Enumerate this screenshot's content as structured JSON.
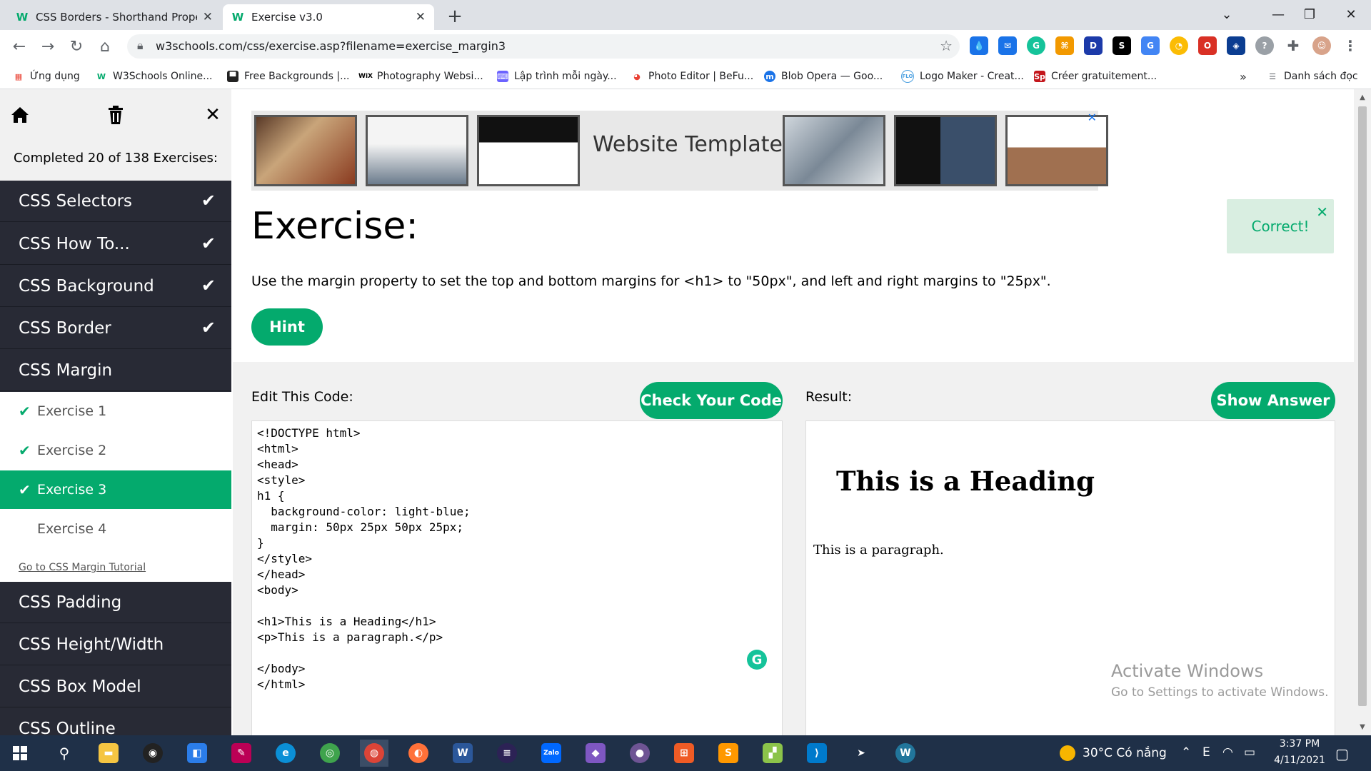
{
  "browser": {
    "tabs": [
      {
        "title": "CSS Borders - Shorthand Propert",
        "favicon": "W"
      },
      {
        "title": "Exercise v3.0",
        "favicon": "W"
      }
    ],
    "url": "w3schools.com/css/exercise.asp?filename=exercise_margin3",
    "bookmarks": [
      "Ứng dụng",
      "W3Schools Online...",
      "Free Backgrounds |...",
      "Photography Websi...",
      "Lập trình mỗi ngày...",
      "Photo Editor | BeFu...",
      "Blob Opera — Goo...",
      "Logo Maker - Creat...",
      "Créer gratuitement..."
    ],
    "reading_list": "Danh sách đọc",
    "bookmark_overflow": "»"
  },
  "sidebar": {
    "progress": "Completed 20 of 138 Exercises:",
    "categories_top": [
      {
        "label": "CSS Selectors",
        "done": true
      },
      {
        "label": "CSS How To...",
        "done": true
      },
      {
        "label": "CSS Background",
        "done": true
      },
      {
        "label": "CSS Border",
        "done": true
      },
      {
        "label": "CSS Margin",
        "done": false
      }
    ],
    "exercises": [
      {
        "label": "Exercise 1",
        "done": true
      },
      {
        "label": "Exercise 2",
        "done": true
      },
      {
        "label": "Exercise 3",
        "done": true
      },
      {
        "label": "Exercise 4",
        "done": false
      }
    ],
    "tutorial_link": "Go to CSS Margin Tutorial",
    "categories_bottom": [
      {
        "label": "CSS Padding"
      },
      {
        "label": "CSS Height/Width"
      },
      {
        "label": "CSS Box Model"
      },
      {
        "label": "CSS Outline"
      }
    ]
  },
  "ad": {
    "text": "Website Templates"
  },
  "exercise": {
    "title": "Exercise:",
    "instruction": "Use the margin property to set the top and bottom margins for <h1> to \"50px\", and left and right margins to \"25px\".",
    "hint_label": "Hint",
    "correct_label": "Correct!",
    "edit_label": "Edit This Code:",
    "check_label": "Check Your Code",
    "result_label": "Result:",
    "answer_label": "Show Answer",
    "code": "<!DOCTYPE html>\n<html>\n<head>\n<style>\nh1 {\n  background-color: light-blue;\n  margin: 50px 25px 50px 25px;\n}\n</style>\n</head>\n<body>\n\n<h1>This is a Heading</h1>\n<p>This is a paragraph.</p>\n\n</body>\n</html>",
    "result_heading": "This is a Heading",
    "result_paragraph": "This is a paragraph."
  },
  "watermark": {
    "line1": "Activate Windows",
    "line2": "Go to Settings to activate Windows."
  },
  "taskbar": {
    "weather": "30°C  Có nắng",
    "time": "3:37 PM",
    "date": "4/11/2021"
  },
  "colors": {
    "accent": "#04aa6d",
    "sidebar_dark": "#282a35",
    "taskbar": "#1f3048"
  }
}
